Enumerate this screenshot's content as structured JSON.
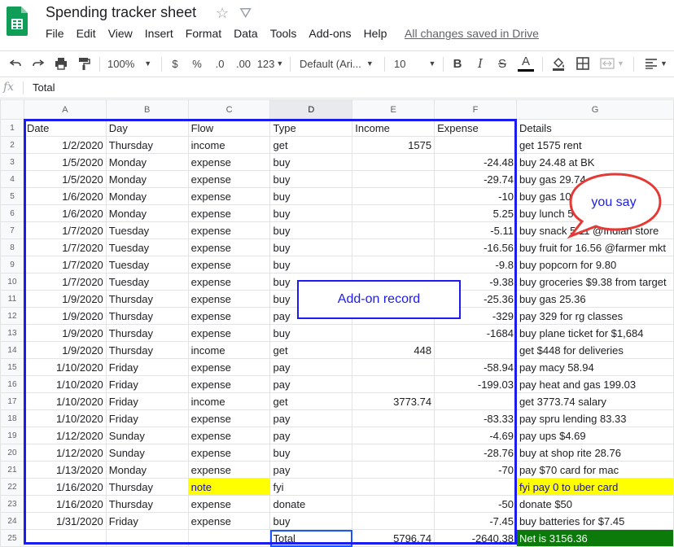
{
  "doc": {
    "title": "Spending tracker sheet",
    "saved_status": "All changes saved in Drive"
  },
  "menu": [
    "File",
    "Edit",
    "View",
    "Insert",
    "Format",
    "Data",
    "Tools",
    "Add-ons",
    "Help"
  ],
  "toolbar": {
    "zoom": "100%",
    "currency": "$",
    "percent": "%",
    "dec_less": ".0",
    "dec_more": ".00",
    "more_formats": "123",
    "font": "Default (Ari...",
    "font_size": "10",
    "bold": "B",
    "italic": "I",
    "strike": "S",
    "text_color": "A"
  },
  "formula_bar": {
    "fx": "fx",
    "value": "Total"
  },
  "columns": [
    "A",
    "B",
    "C",
    "D",
    "E",
    "F",
    "G"
  ],
  "rows": [
    [
      "Date",
      "Day",
      "Flow",
      "Type",
      "Income",
      "Expense",
      "Details"
    ],
    [
      "1/2/2020",
      "Thursday",
      "income",
      "get",
      "1575",
      "",
      "get 1575 rent"
    ],
    [
      "1/5/2020",
      "Monday",
      "expense",
      "buy",
      "",
      "-24.48",
      "buy 24.48 at BK"
    ],
    [
      "1/5/2020",
      "Monday",
      "expense",
      "buy",
      "",
      "-29.74",
      "buy gas 29.74"
    ],
    [
      "1/6/2020",
      "Monday",
      "expense",
      "buy",
      "",
      "-10",
      "buy gas 10"
    ],
    [
      "1/6/2020",
      "Monday",
      "expense",
      "buy",
      "",
      "5.25",
      "buy lunch 5"
    ],
    [
      "1/7/2020",
      "Tuesday",
      "expense",
      "buy",
      "",
      "-5.11",
      "buy snack 5.11 @Indian store"
    ],
    [
      "1/7/2020",
      "Tuesday",
      "expense",
      "buy",
      "",
      "-16.56",
      "buy fruit for 16.56 @farmer mkt"
    ],
    [
      "1/7/2020",
      "Tuesday",
      "expense",
      "buy",
      "",
      "-9.8",
      "buy popcorn for 9.80"
    ],
    [
      "1/7/2020",
      "Tuesday",
      "expense",
      "buy",
      "",
      "-9.38",
      "buy groceries $9.38 from target"
    ],
    [
      "1/9/2020",
      "Thursday",
      "expense",
      "buy",
      "",
      "-25.36",
      "buy gas 25.36"
    ],
    [
      "1/9/2020",
      "Thursday",
      "expense",
      "pay",
      "",
      "-329",
      "pay 329 for rg classes"
    ],
    [
      "1/9/2020",
      "Thursday",
      "expense",
      "buy",
      "",
      "-1684",
      "buy plane ticket for $1,684"
    ],
    [
      "1/9/2020",
      "Thursday",
      "income",
      "get",
      "448",
      "",
      "get $448 for deliveries"
    ],
    [
      "1/10/2020",
      "Friday",
      "expense",
      "pay",
      "",
      "-58.94",
      "pay macy 58.94"
    ],
    [
      "1/10/2020",
      "Friday",
      "expense",
      "pay",
      "",
      "-199.03",
      "pay heat and gas 199.03"
    ],
    [
      "1/10/2020",
      "Friday",
      "income",
      "get",
      "3773.74",
      "",
      "get 3773.74 salary"
    ],
    [
      "1/10/2020",
      "Friday",
      "expense",
      "pay",
      "",
      "-83.33",
      "pay spru lending 83.33"
    ],
    [
      "1/12/2020",
      "Sunday",
      "expense",
      "pay",
      "",
      "-4.69",
      "pay ups $4.69"
    ],
    [
      "1/12/2020",
      "Sunday",
      "expense",
      "buy",
      "",
      "-28.76",
      "buy at shop rite 28.76"
    ],
    [
      "1/13/2020",
      "Monday",
      "expense",
      "pay",
      "",
      "-70",
      "pay $70 card for mac"
    ],
    [
      "1/16/2020",
      "Thursday",
      "note",
      "fyi",
      "",
      "",
      "fyi pay 0 to uber card"
    ],
    [
      "1/16/2020",
      "Thursday",
      "expense",
      "donate",
      "",
      "-50",
      "donate $50"
    ],
    [
      "1/31/2020",
      "Friday",
      "expense",
      "buy",
      "",
      "-7.45",
      "buy batteries for $7.45"
    ],
    [
      "",
      "",
      "",
      "Total",
      "5796.74",
      "-2640.38",
      "Net is 3156.36"
    ]
  ],
  "annotations": {
    "addon_label": "Add-on record",
    "bubble_label": "you say"
  },
  "colors": {
    "highlight": "#ffff00",
    "net_cell": "#0b7a0b",
    "annotation_blue": "#1c1cf0",
    "bubble_red": "#e53935"
  }
}
